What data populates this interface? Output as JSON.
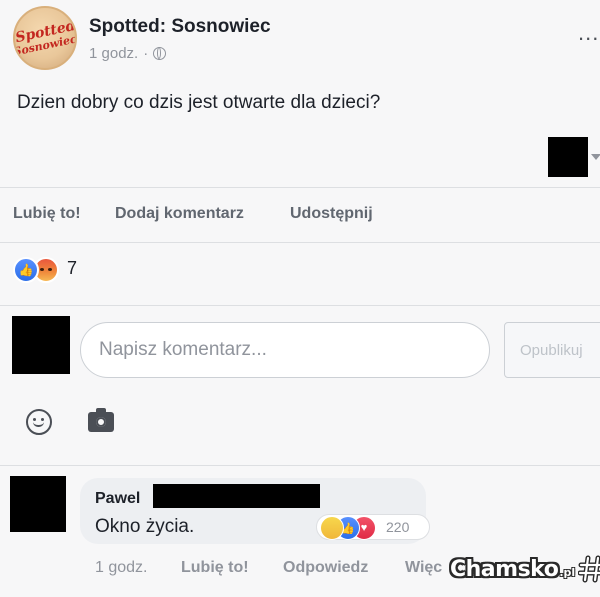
{
  "post": {
    "page_name": "Spotted: Sosnowiec",
    "logo_text": [
      "Spotted",
      "Sosnowiec"
    ],
    "time": "1 godz.",
    "separator": "·",
    "privacy_icon": "globe-icon",
    "more_icon": "...",
    "text": "Dzien dobry co dzis jest otwarte dla dzieci?"
  },
  "actions": {
    "like": "Lubię to!",
    "comment": "Dodaj komentarz",
    "share": "Udostępnij"
  },
  "reactions": {
    "icons": [
      "like-icon",
      "angry-icon"
    ],
    "count": "7"
  },
  "composer": {
    "placeholder": "Napisz komentarz...",
    "publish": "Opublikuj",
    "icons": [
      "emoji-icon",
      "camera-icon"
    ]
  },
  "comment": {
    "author": "Pawel",
    "text": "Okno życia.",
    "reaction_icons": [
      "haha-icon",
      "like-icon",
      "love-icon"
    ],
    "reaction_count": "220",
    "time": "1 godz.",
    "like": "Lubię to!",
    "reply": "Odpowiedz",
    "more": "Więc"
  },
  "watermark": {
    "name": "Chamsko",
    "tld": ".pl"
  },
  "colors": {
    "background": "#f7f7f8",
    "text": "#1d2129",
    "secondary_text": "#90949c",
    "like_blue": "#2a6ee8",
    "love_red": "#e02a45",
    "redaction": "#000000"
  }
}
